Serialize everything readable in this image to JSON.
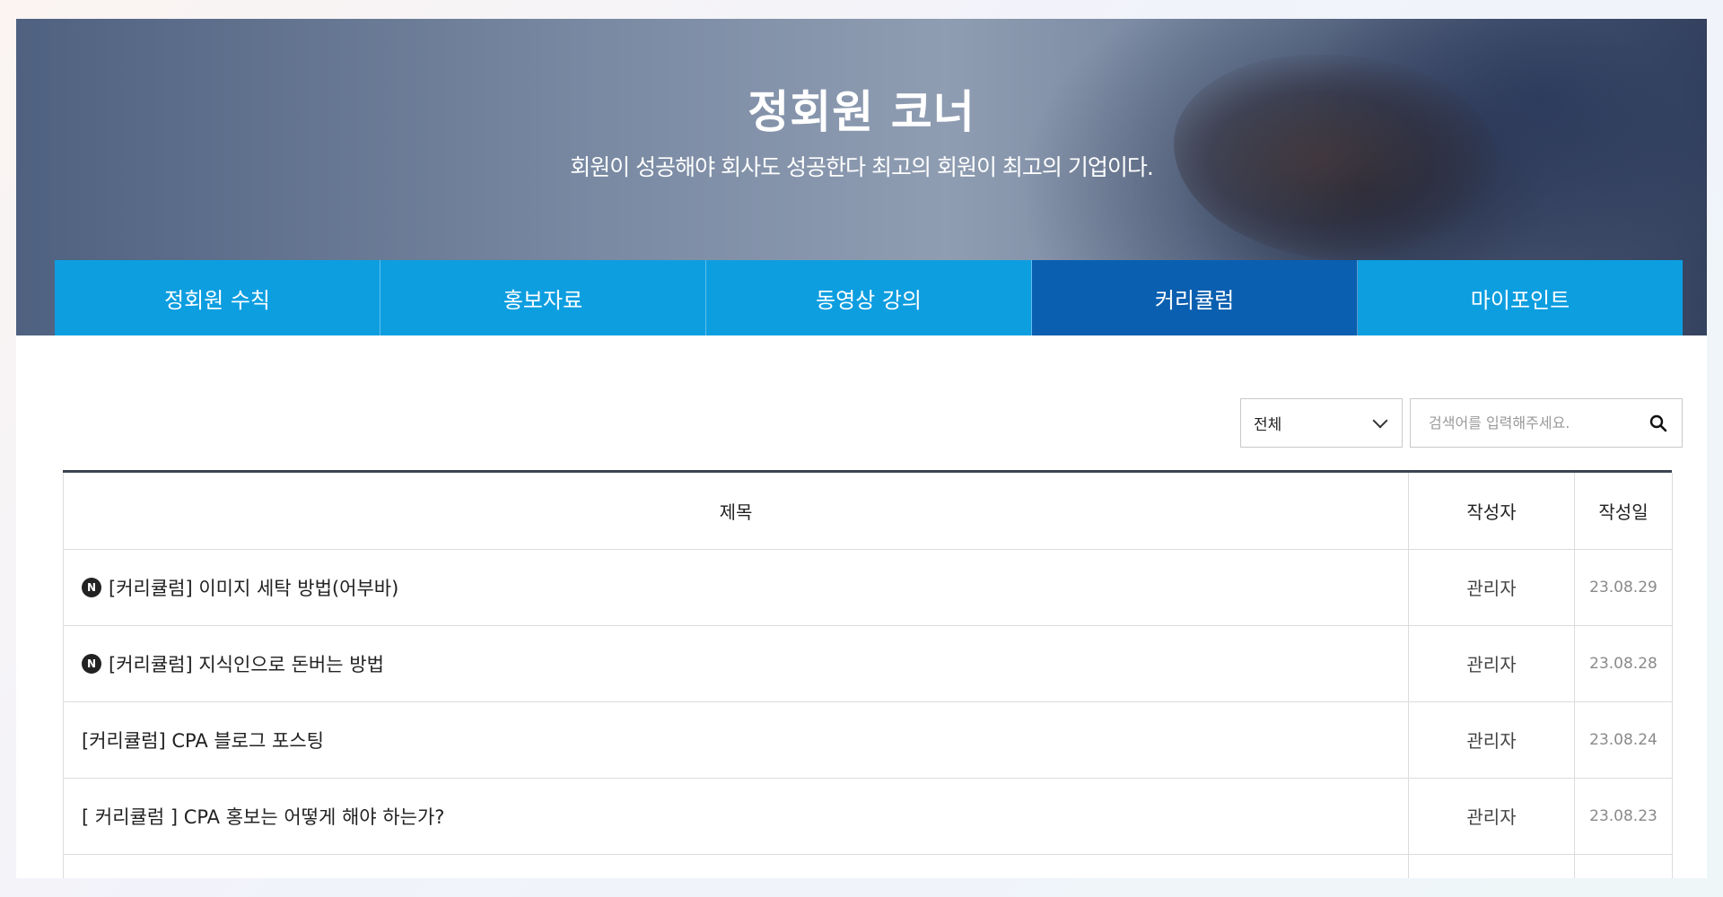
{
  "hero": {
    "title": "정회원 코너",
    "subtitle": "회원이 성공해야 회사도 성공한다 최고의 회원이 최고의 기업이다."
  },
  "tabs": [
    {
      "label": "정회원 수칙",
      "active": false
    },
    {
      "label": "홍보자료",
      "active": false
    },
    {
      "label": "동영상 강의",
      "active": false
    },
    {
      "label": "커리큘럼",
      "active": true
    },
    {
      "label": "마이포인트",
      "active": false
    }
  ],
  "search": {
    "filter_value": "전체",
    "placeholder": "검색어를 입력해주세요.",
    "icon": "search-icon"
  },
  "board": {
    "headers": {
      "title": "제목",
      "author": "작성자",
      "date": "작성일"
    },
    "rows": [
      {
        "is_new": true,
        "badge": "N",
        "title": "[커리큘럼] 이미지 세탁 방법(어부바)",
        "author": "관리자",
        "date": "23.08.29"
      },
      {
        "is_new": true,
        "badge": "N",
        "title": "[커리큘럼] 지식인으로 돈버는 방법",
        "author": "관리자",
        "date": "23.08.28"
      },
      {
        "is_new": false,
        "badge": "",
        "title": "[커리큘럼] CPA 블로그 포스팅",
        "author": "관리자",
        "date": "23.08.24"
      },
      {
        "is_new": false,
        "badge": "",
        "title": "[ 커리큘럼 ] CPA 홍보는 어떻게 해야 하는가?",
        "author": "관리자",
        "date": "23.08.23"
      }
    ]
  },
  "colors": {
    "tab_bg": "#0d9ee0",
    "tab_active_bg": "#0a5fb0",
    "board_top_border": "#3d4452"
  }
}
